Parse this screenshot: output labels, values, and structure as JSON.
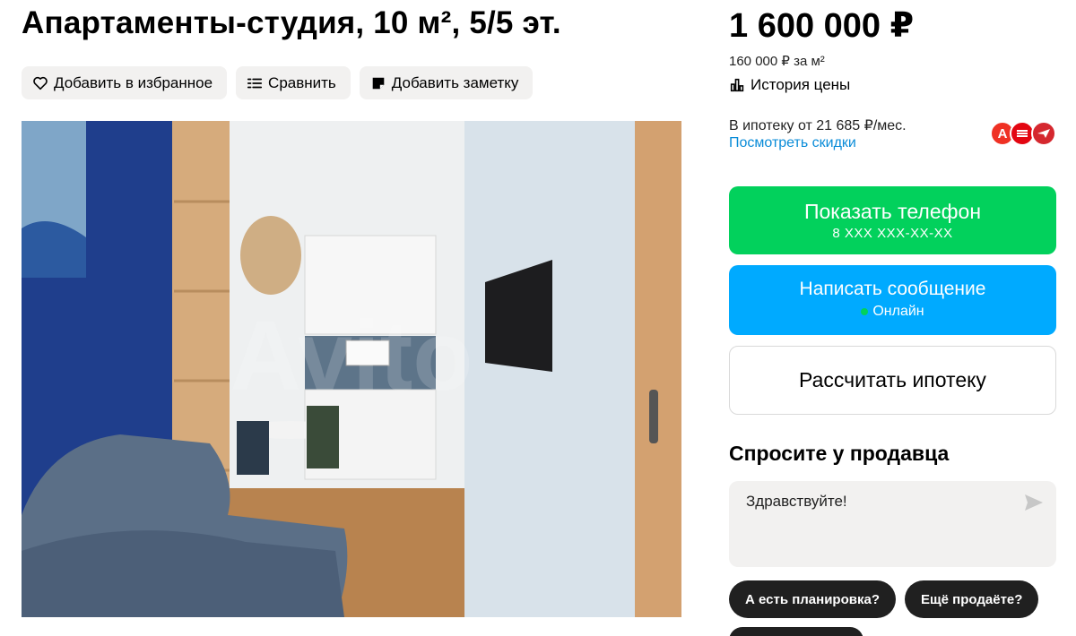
{
  "listing": {
    "title": "Апартаменты-студия, 10 м², 5/5 эт.",
    "actions": [
      {
        "label": "Добавить в избранное",
        "icon": "heart-icon"
      },
      {
        "label": "Сравнить",
        "icon": "compare-icon"
      },
      {
        "label": "Добавить заметку",
        "icon": "note-icon"
      }
    ],
    "photo_watermark": "Avito"
  },
  "price": {
    "value": "1 600 000 ₽",
    "per_sqm": "160 000 ₽ за м²",
    "history_label": "История цены"
  },
  "mortgage": {
    "text": "В ипотеку от 21 685 ₽/мес.",
    "discounts_link": "Посмотреть скидки",
    "bank_alfa_letter": "А"
  },
  "contact": {
    "show_phone_label": "Показать телефон",
    "phone_masked": "8 XXX XXX-XX-XX",
    "message_label": "Написать сообщение",
    "online_status": "Онлайн",
    "calc_label": "Рассчитать ипотеку"
  },
  "ask": {
    "title": "Спросите у продавца",
    "input_value": "Здравствуйте!",
    "chips": [
      "А есть планировка?",
      "Ещё продаёте?"
    ]
  },
  "colors": {
    "green": "#02d15c",
    "blue": "#00aaff",
    "link": "#0a8cd8",
    "chip": "#202020",
    "soft_bg": "#f2f1f0"
  }
}
